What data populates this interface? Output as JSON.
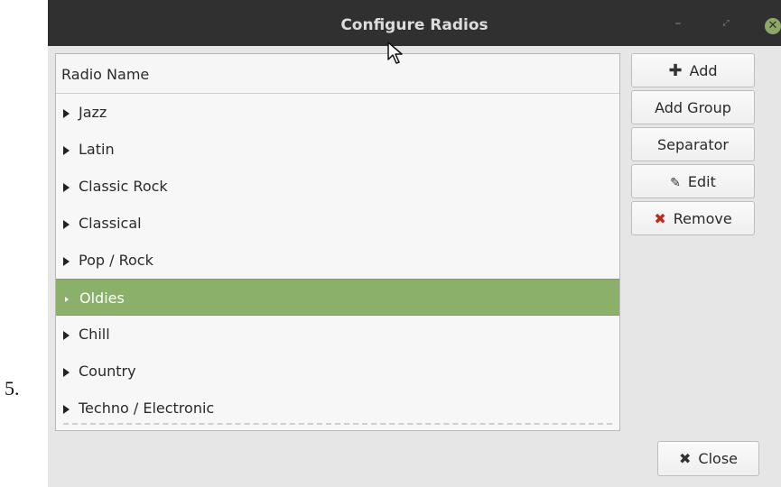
{
  "page_number": "5.",
  "window": {
    "title": "Configure Radios",
    "controls": {
      "minimize": "–",
      "maximize": "⤢",
      "close": "✕"
    }
  },
  "list": {
    "header": "Radio Name",
    "items": [
      {
        "label": "Jazz"
      },
      {
        "label": "Latin"
      },
      {
        "label": "Classic Rock"
      },
      {
        "label": "Classical"
      },
      {
        "label": "Pop / Rock"
      },
      {
        "label": "Oldies",
        "selected": true
      },
      {
        "label": "Chill"
      },
      {
        "label": "Country"
      },
      {
        "label": "Techno / Electronic"
      }
    ]
  },
  "buttons": {
    "add": "Add",
    "add_group": "Add Group",
    "separator": "Separator",
    "edit": "Edit",
    "remove": "Remove",
    "close": "Close"
  },
  "icons": {
    "add": "plus-icon",
    "edit": "pencil-icon",
    "remove": "x-icon",
    "close": "x-icon"
  },
  "colors": {
    "titlebar": "#303030",
    "selection": "#8ab06a",
    "close_button": "#8ba964",
    "remove_icon": "#c0281c"
  }
}
